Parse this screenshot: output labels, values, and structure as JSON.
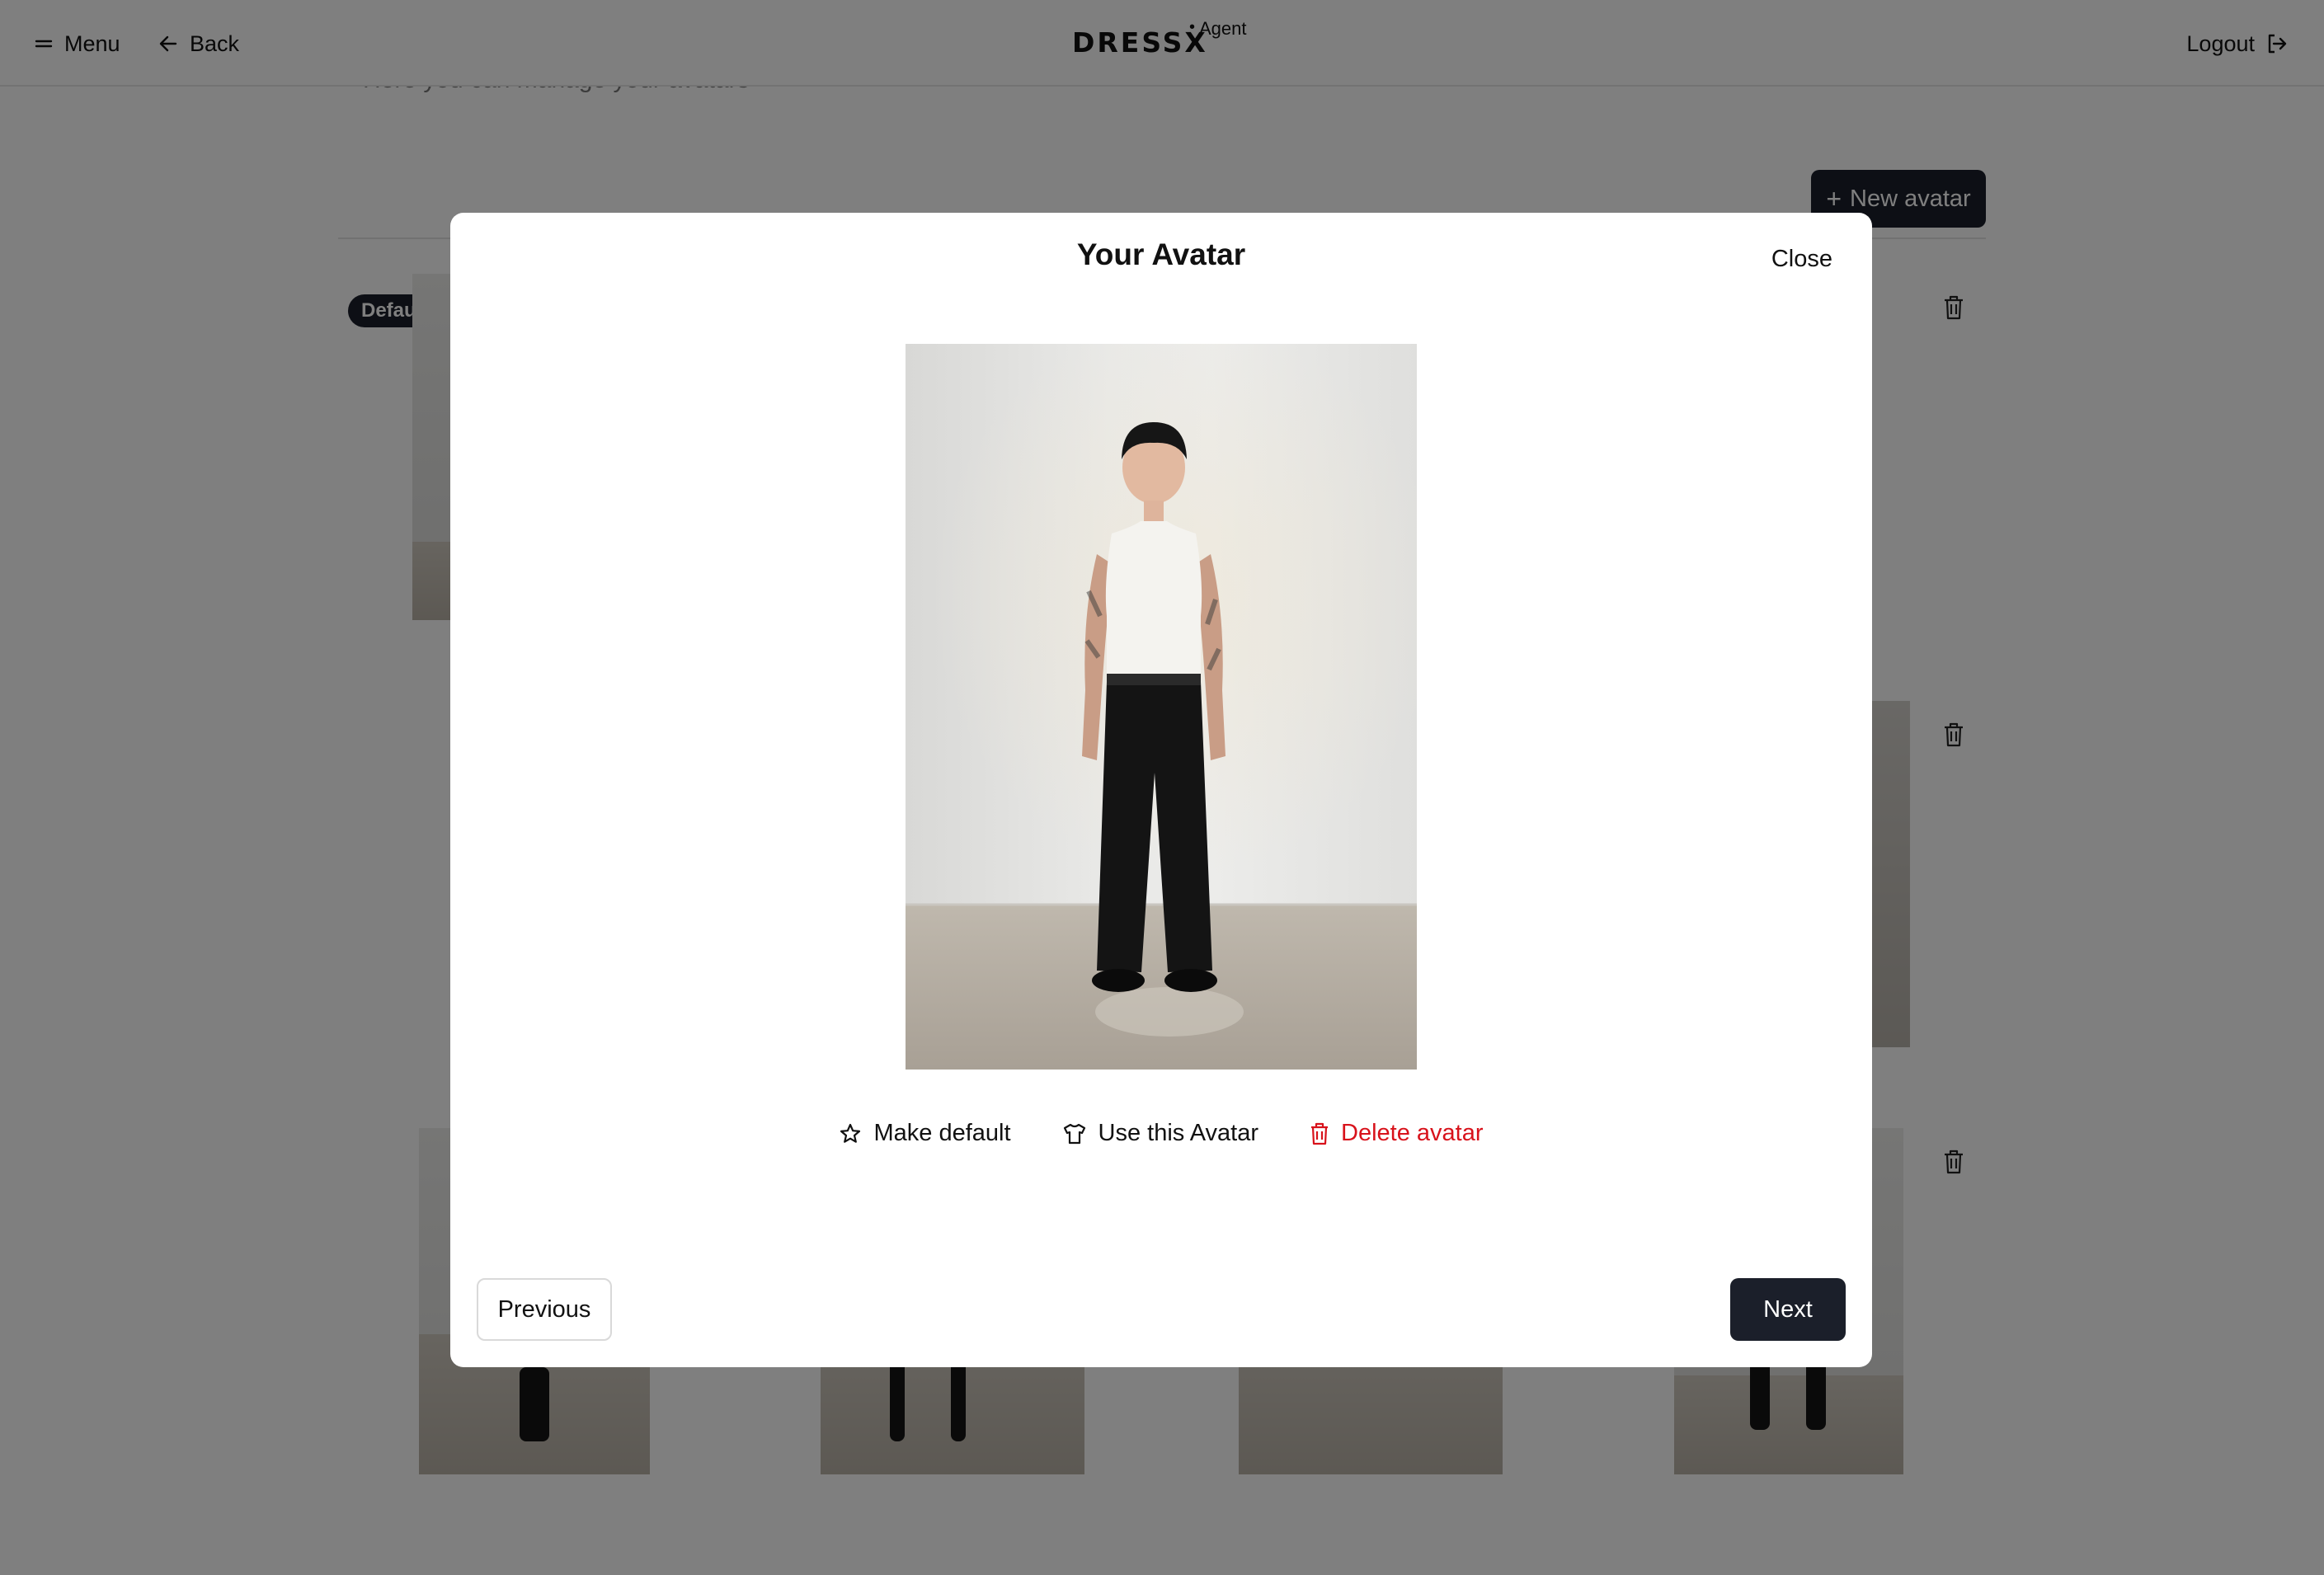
{
  "header": {
    "menu_label": "Menu",
    "back_label": "Back",
    "logo": {
      "brand": "DRESSX",
      "sup": "Agent"
    },
    "logout_label": "Logout"
  },
  "page": {
    "subtitle": "Here you can manage your avatars",
    "new_avatar_label": "New avatar",
    "default_badge": "Default"
  },
  "modal": {
    "title": "Your Avatar",
    "close_label": "Close",
    "image_alt": "Avatar photo of a person in a white tank top and black pants",
    "actions": {
      "make_default": "Make default",
      "use_avatar": "Use this Avatar",
      "delete_avatar": "Delete avatar"
    },
    "previous_label": "Previous",
    "next_label": "Next"
  },
  "colors": {
    "primary_dark": "#1b1f2a",
    "danger": "#d8121b",
    "overlay": "rgba(0,0,0,0.5)"
  }
}
